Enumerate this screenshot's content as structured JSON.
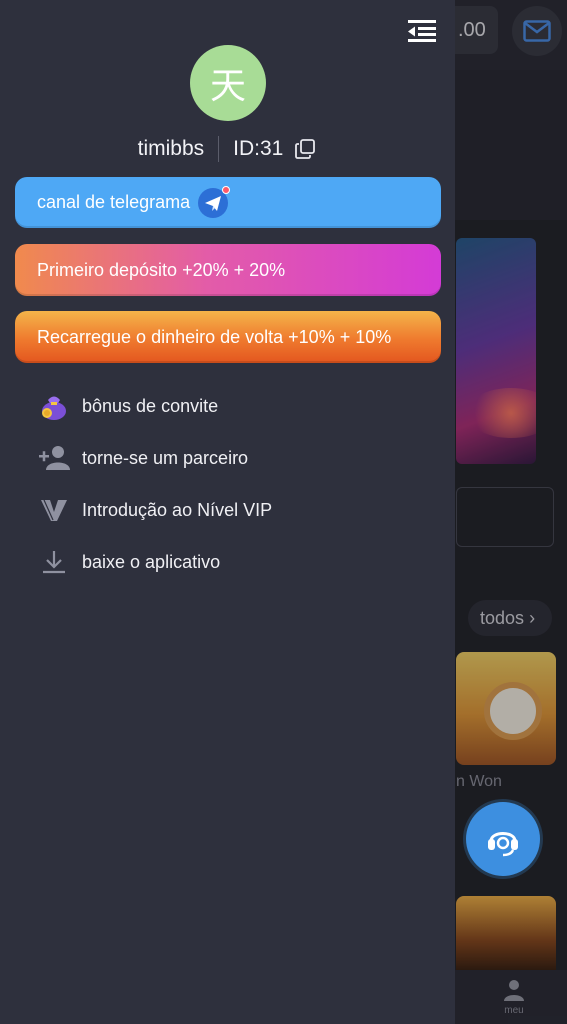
{
  "background": {
    "balance_fragment": ".00",
    "todos_label": "todos",
    "todos_chevron": "›",
    "game_name_fragment": "n Won",
    "bottom_nav_label": "meu"
  },
  "drawer": {
    "avatar_char": "天",
    "username": "timibbs",
    "user_id": "ID:31",
    "promos": {
      "telegram": "canal de telegrama",
      "deposit": "Primeiro depósito +20% + 20%",
      "cashback": "Recarregue o dinheiro de volta +10% + 10%"
    },
    "menu": [
      {
        "label": "bônus de convite",
        "icon": "money-bag-icon"
      },
      {
        "label": "torne-se um parceiro",
        "icon": "add-person-icon"
      },
      {
        "label": "Introdução ao Nível VIP",
        "icon": "vip-v-icon"
      },
      {
        "label": "baixe o aplicativo",
        "icon": "download-icon"
      }
    ]
  },
  "colors": {
    "drawer_bg": "#2e303d",
    "telegram": "#4ea8f5",
    "deposit_gradient": [
      "#f08a4d",
      "#d43bd6"
    ],
    "cashback_gradient": [
      "#f4b44a",
      "#e3561f"
    ],
    "avatar_bg": "#a8dc96",
    "support_button": "#3d8fe0"
  }
}
